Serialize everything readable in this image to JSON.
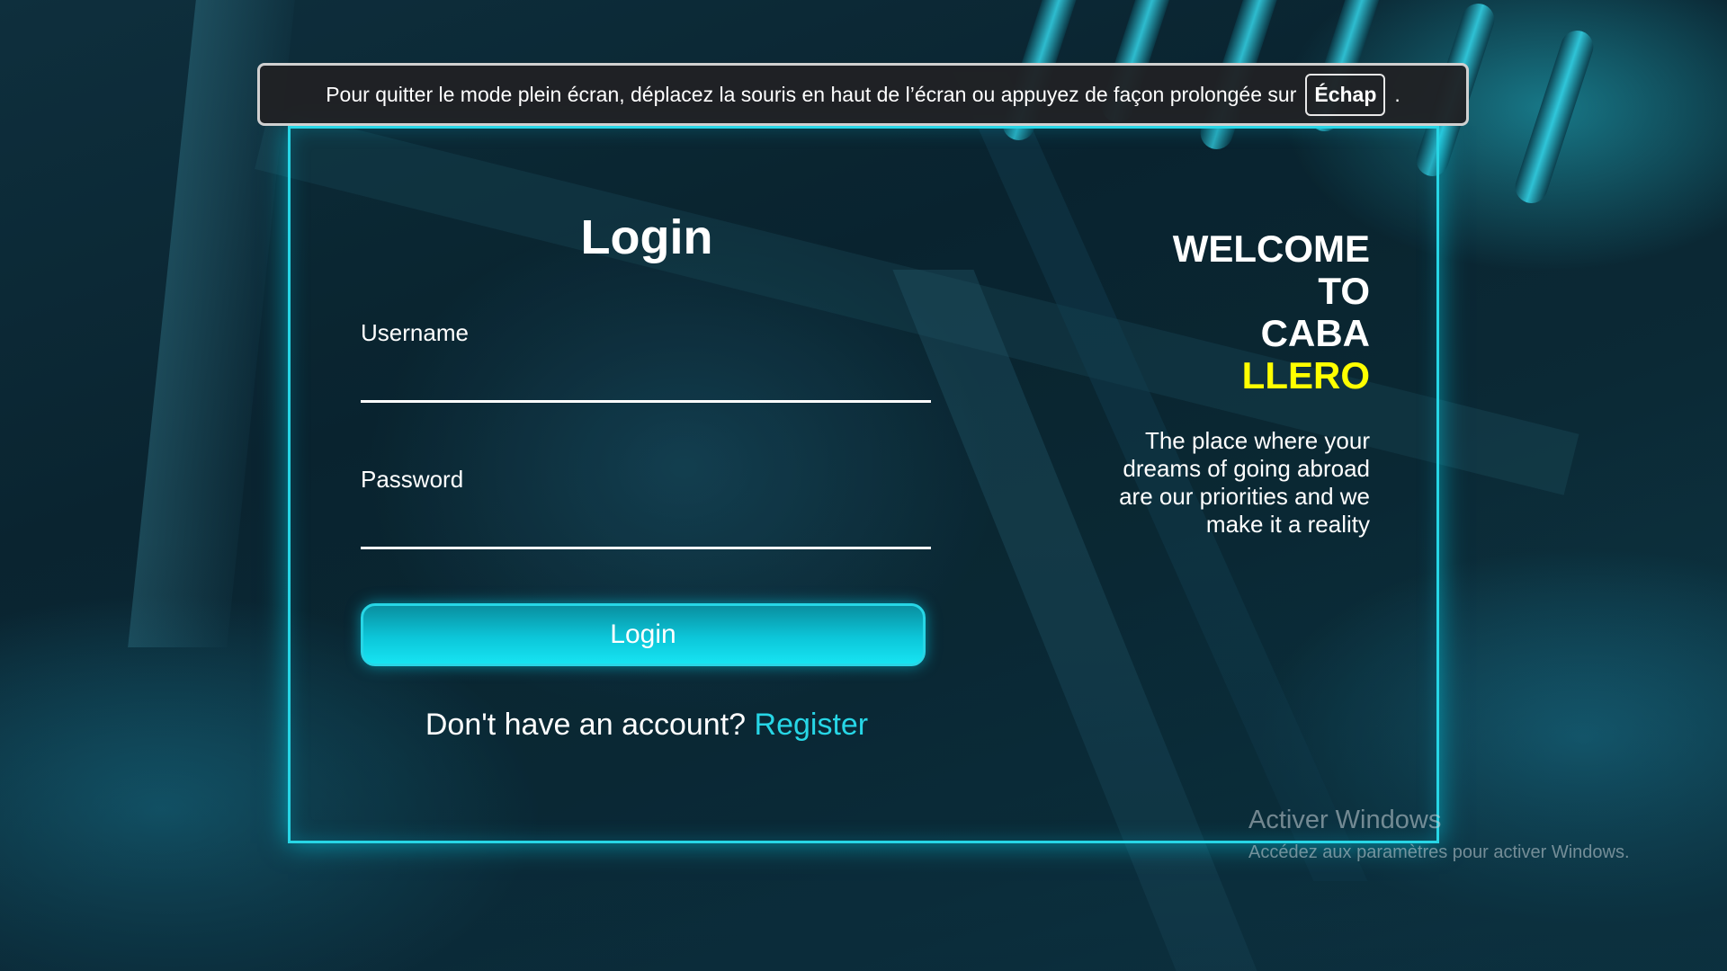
{
  "fullscreen_notice": {
    "text": "Pour quitter le mode plein écran, déplacez la souris en haut de l’écran ou appuyez de façon prolongée sur",
    "key": "Échap",
    "suffix": "."
  },
  "login_form": {
    "title": "Login",
    "username_label": "Username",
    "username_value": "",
    "password_label": "Password",
    "password_value": "",
    "submit_label": "Login",
    "register_prompt": "Don't have an account?",
    "register_link": "Register"
  },
  "welcome": {
    "lines": [
      "WELCOME",
      "TO",
      "CABA"
    ],
    "accent_line": "LLERO",
    "tagline": "The place where your dreams of going abroad are our priorities and we make it a reality"
  },
  "windows_watermark": {
    "title": "Activer Windows",
    "subtitle": "Accédez aux paramètres pour activer Windows."
  },
  "colors": {
    "accent": "#27d6e6",
    "highlight": "#ffff00"
  }
}
